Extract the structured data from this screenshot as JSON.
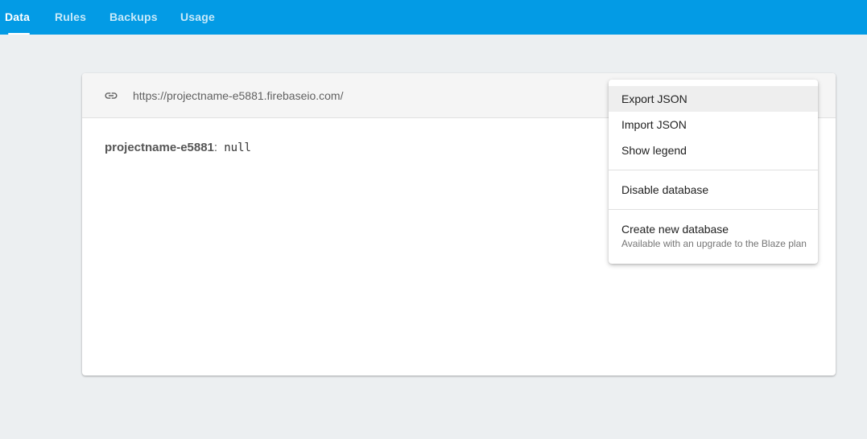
{
  "tabs": [
    {
      "label": "Data",
      "active": true
    },
    {
      "label": "Rules",
      "active": false
    },
    {
      "label": "Backups",
      "active": false
    },
    {
      "label": "Usage",
      "active": false
    }
  ],
  "database": {
    "url": "https://projectname-e5881.firebaseio.com/",
    "root_key": "projectname-e5881",
    "separator": ":",
    "root_value": "null"
  },
  "menu": {
    "items": [
      {
        "label": "Export JSON",
        "highlighted": true
      },
      {
        "label": "Import JSON"
      },
      {
        "label": "Show legend"
      },
      {
        "label": "Disable database"
      },
      {
        "label": "Create new database",
        "sublabel": "Available with an upgrade to the Blaze plan"
      }
    ]
  },
  "icons": {
    "url_icon": "link-icon"
  },
  "colors": {
    "header_bar": "#039be5",
    "background": "#eceff1",
    "menu_hover": "#eeeeee"
  }
}
